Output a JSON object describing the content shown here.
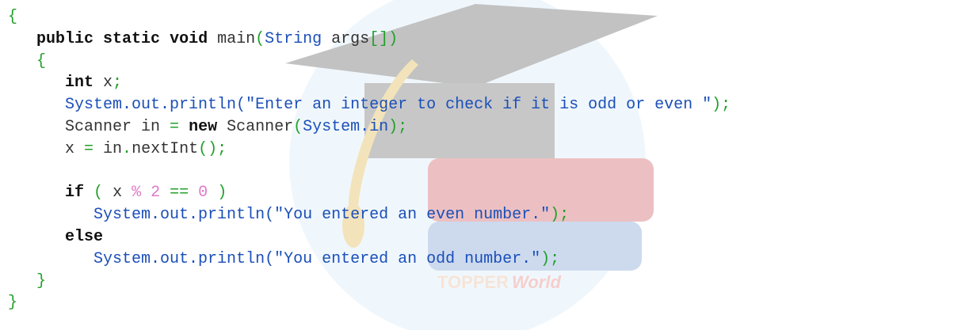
{
  "watermark": {
    "brand_left": "TOPPER",
    "brand_right": "World",
    "colors": {
      "brand_left": "#e8a87c",
      "brand_right": "#e3605a",
      "cap": "#3a3a3a",
      "tassel": "#d7a51e",
      "circle": "#cfe6f7",
      "book_red": "#c2323a",
      "book_blue": "#5d88c9"
    }
  },
  "code": {
    "colors": {
      "keyword": "#111111",
      "text": "#333333",
      "punctuation": "#22a02a",
      "string": "#1b4fb8",
      "method_call": "#1b4fb8",
      "number": "#e07ac8"
    },
    "lines": [
      [
        {
          "t": "{",
          "c": "pu"
        }
      ],
      [
        {
          "t": "   ",
          "c": "tx"
        },
        {
          "t": "public",
          "c": "kw"
        },
        {
          "t": " ",
          "c": "tx"
        },
        {
          "t": "static",
          "c": "kw"
        },
        {
          "t": " ",
          "c": "tx"
        },
        {
          "t": "void",
          "c": "kw"
        },
        {
          "t": " main",
          "c": "tx"
        },
        {
          "t": "(",
          "c": "pu"
        },
        {
          "t": "String",
          "c": "mc"
        },
        {
          "t": " args",
          "c": "tx"
        },
        {
          "t": "[])",
          "c": "pu"
        }
      ],
      [
        {
          "t": "   ",
          "c": "tx"
        },
        {
          "t": "{",
          "c": "pu"
        }
      ],
      [
        {
          "t": "      ",
          "c": "tx"
        },
        {
          "t": "int",
          "c": "kw"
        },
        {
          "t": " x",
          "c": "tx"
        },
        {
          "t": ";",
          "c": "pu"
        }
      ],
      [
        {
          "t": "      ",
          "c": "tx"
        },
        {
          "t": "System.out.println(",
          "c": "mc"
        },
        {
          "t": "\"Enter an integer to check if it is odd or even \"",
          "c": "st"
        },
        {
          "t": ");",
          "c": "pu"
        }
      ],
      [
        {
          "t": "      Scanner in ",
          "c": "tx"
        },
        {
          "t": "=",
          "c": "op"
        },
        {
          "t": " ",
          "c": "tx"
        },
        {
          "t": "new",
          "c": "kw"
        },
        {
          "t": " Scanner",
          "c": "tx"
        },
        {
          "t": "(",
          "c": "pu"
        },
        {
          "t": "System.in",
          "c": "mc"
        },
        {
          "t": ");",
          "c": "pu"
        }
      ],
      [
        {
          "t": "      x ",
          "c": "tx"
        },
        {
          "t": "=",
          "c": "op"
        },
        {
          "t": " in",
          "c": "tx"
        },
        {
          "t": ".",
          "c": "pu"
        },
        {
          "t": "nextInt",
          "c": "tx"
        },
        {
          "t": "();",
          "c": "pu"
        }
      ],
      [],
      [
        {
          "t": "      ",
          "c": "tx"
        },
        {
          "t": "if",
          "c": "kw"
        },
        {
          "t": " ",
          "c": "tx"
        },
        {
          "t": "(",
          "c": "pu"
        },
        {
          "t": " x ",
          "c": "tx"
        },
        {
          "t": "%",
          "c": "nu"
        },
        {
          "t": " ",
          "c": "tx"
        },
        {
          "t": "2",
          "c": "nu"
        },
        {
          "t": " ",
          "c": "tx"
        },
        {
          "t": "==",
          "c": "op"
        },
        {
          "t": " ",
          "c": "tx"
        },
        {
          "t": "0",
          "c": "nu"
        },
        {
          "t": " ",
          "c": "tx"
        },
        {
          "t": ")",
          "c": "pu"
        }
      ],
      [
        {
          "t": "         ",
          "c": "tx"
        },
        {
          "t": "System.out.println(",
          "c": "mc"
        },
        {
          "t": "\"You entered an even number.\"",
          "c": "st"
        },
        {
          "t": ");",
          "c": "pu"
        }
      ],
      [
        {
          "t": "      ",
          "c": "tx"
        },
        {
          "t": "else",
          "c": "kw"
        }
      ],
      [
        {
          "t": "         ",
          "c": "tx"
        },
        {
          "t": "System.out.println(",
          "c": "mc"
        },
        {
          "t": "\"You entered an odd number.\"",
          "c": "st"
        },
        {
          "t": ");",
          "c": "pu"
        }
      ],
      [
        {
          "t": "   ",
          "c": "tx"
        },
        {
          "t": "}",
          "c": "pu"
        }
      ],
      [
        {
          "t": "}",
          "c": "pu"
        }
      ]
    ]
  }
}
